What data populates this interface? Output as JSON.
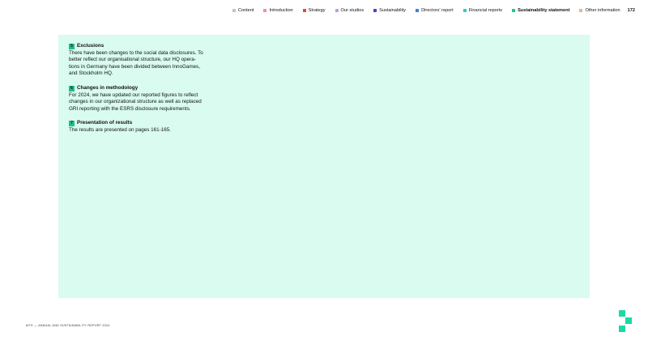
{
  "nav": {
    "items": [
      {
        "label": "Content",
        "color": "#c4c4c4"
      },
      {
        "label": "Introduction",
        "color": "#f08fa0"
      },
      {
        "label": "Strategy",
        "color": "#e84545"
      },
      {
        "label": "Our studios",
        "color": "#c39be8"
      },
      {
        "label": "Sustainability",
        "color": "#5b3ec8"
      },
      {
        "label": "Directors' report",
        "color": "#4a7be0"
      },
      {
        "label": "Financial reports",
        "color": "#33ccc4"
      },
      {
        "label": "Sustainability statement",
        "color": "#1dc98c",
        "active": true
      },
      {
        "label": "Other information",
        "color": "#f0b48a"
      }
    ],
    "page_number": "172"
  },
  "sections": [
    {
      "number": "5",
      "title": "Exclusions",
      "lines": [
        "There have been changes to the social data disclosures. To",
        "better reflect our organisational structure, our HQ opera-",
        "tions in Germany have been divided between InnoGames,",
        "and Stockholm HQ."
      ]
    },
    {
      "number": "6",
      "title": "Changes in methodology",
      "lines": [
        "For 2024, we have updated our reported figures to reflect",
        "changes in our organizational structure as well as replaced",
        "GRI reporting with the ESRS disclosure requirements."
      ]
    },
    {
      "number": "7",
      "title": "Presentation of results",
      "lines": [
        "The results are presented on pages 161-165."
      ]
    }
  ],
  "footer": {
    "text": "MTG — ANNUAL AND SUSTAINABILITY REPORT 2024"
  },
  "colors": {
    "panel_background": "#d9fbf0",
    "accent": "#1fbf84",
    "logo": "#1dd8a4"
  }
}
